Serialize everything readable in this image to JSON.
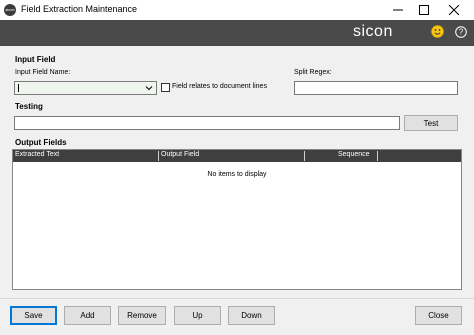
{
  "window": {
    "title": "Field Extraction Maintenance",
    "app_icon_text": "sicon"
  },
  "brand": {
    "logo_text": "sicon",
    "bar_color": "#4a4a4a",
    "smiley_icon": "smiley-icon",
    "help_icon": "help-icon"
  },
  "input_field": {
    "section_title": "Input Field",
    "name_label": "Input Field Name:",
    "name_value": "",
    "document_lines_label": "Field relates to document lines",
    "document_lines_checked": false,
    "split_regex_label": "Split Regex:",
    "split_regex_value": ""
  },
  "testing": {
    "section_title": "Testing",
    "test_value": "",
    "test_button": "Test"
  },
  "output_fields": {
    "section_title": "Output Fields",
    "columns": [
      "Extracted Text",
      "Output Field",
      "Sequence"
    ],
    "empty_message": "No items to display"
  },
  "footer": {
    "save": "Save",
    "add": "Add",
    "remove": "Remove",
    "up": "Up",
    "down": "Down",
    "close": "Close"
  },
  "colors": {
    "accent": "#0078d7",
    "header_bg": "#3f3f3f",
    "combo_bg": "#eef6ee"
  }
}
